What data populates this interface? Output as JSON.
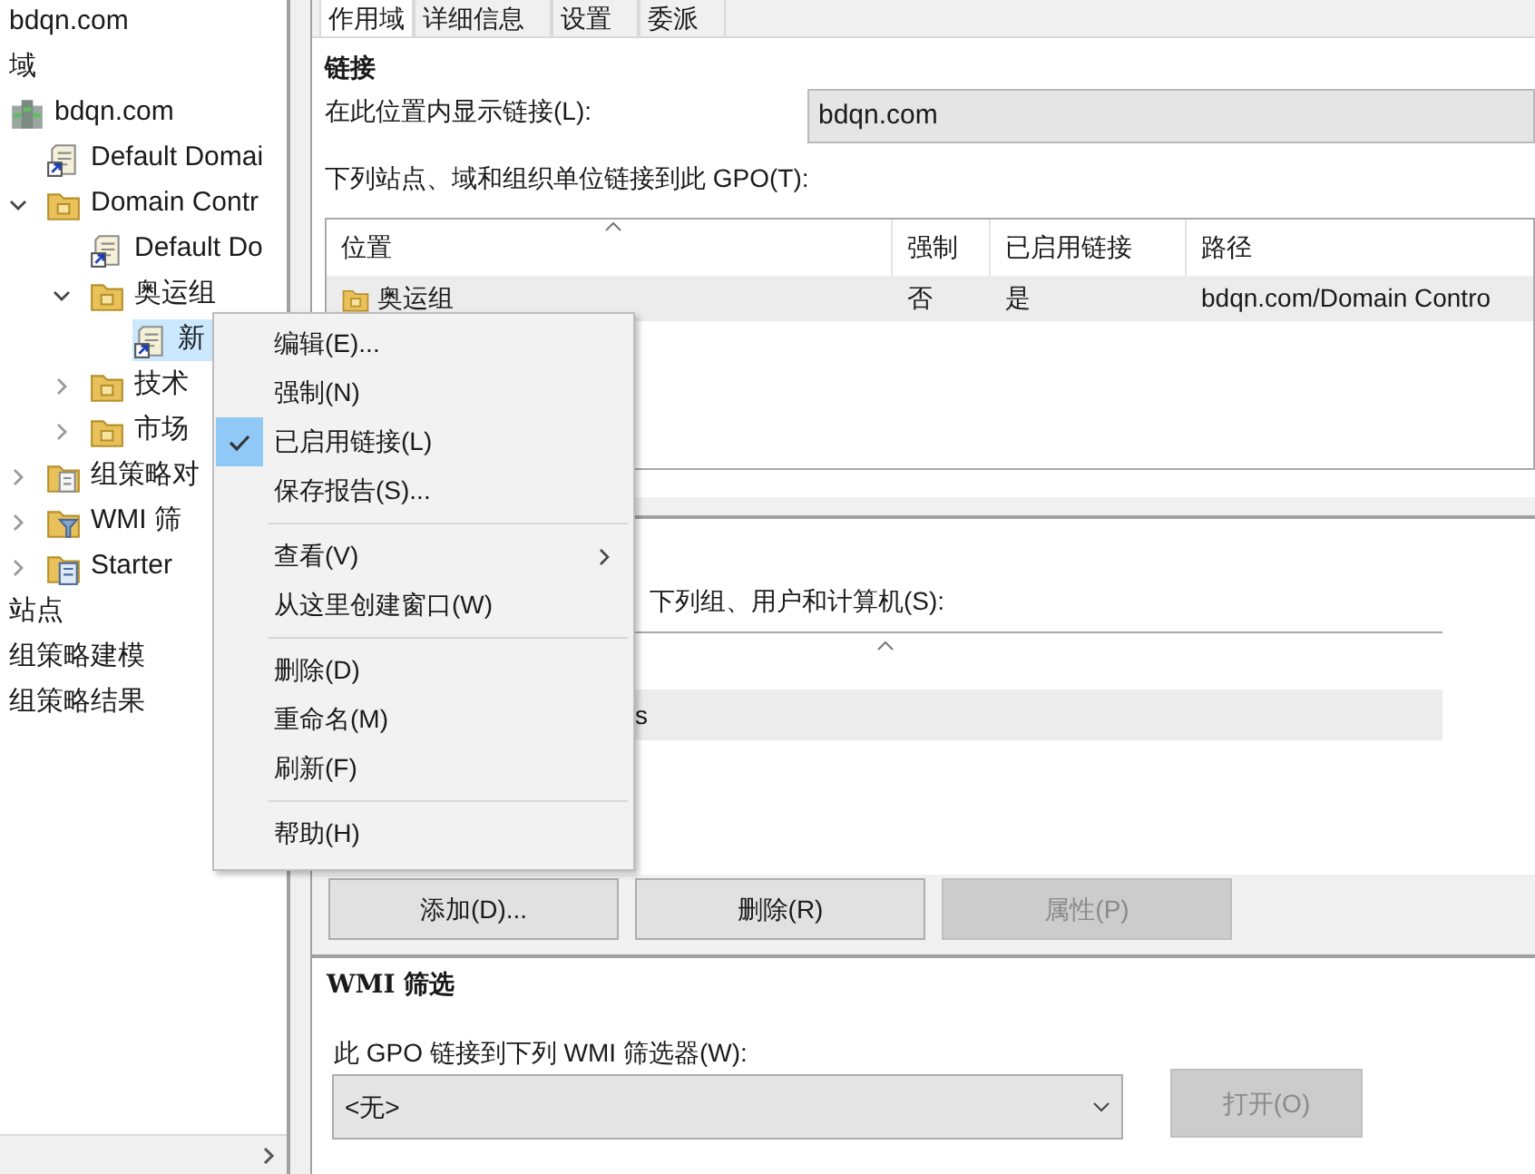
{
  "tree": [
    {
      "label": "bdqn.com",
      "kind": "text",
      "selected": false
    },
    {
      "label": "域",
      "kind": "text",
      "selected": false
    },
    {
      "label": "bdqn.com",
      "kind": "domain",
      "selected": false,
      "children": [
        {
          "label": "Default Domai",
          "kind": "gpo",
          "selected": false
        },
        {
          "label": "Domain Contr",
          "kind": "folder",
          "expanded": true,
          "selected": false,
          "children": [
            {
              "label": "Default Do",
              "kind": "gpo",
              "selected": false
            },
            {
              "label": "奥运组",
              "kind": "folder",
              "expanded": true,
              "selected": false,
              "children": [
                {
                  "label": "新",
                  "kind": "gpo",
                  "selected": true
                }
              ]
            },
            {
              "label": "技术",
              "kind": "folder",
              "expanded": false,
              "selected": false
            },
            {
              "label": "市场",
              "kind": "folder",
              "expanded": false,
              "selected": false
            }
          ]
        },
        {
          "label": "组策略对",
          "kind": "gpofolder",
          "expanded": false,
          "selected": false
        },
        {
          "label": "WMI 筛",
          "kind": "wmifolder",
          "expanded": false,
          "selected": false
        },
        {
          "label": "Starter",
          "kind": "starterfolder",
          "expanded": false,
          "selected": false
        }
      ]
    },
    {
      "label": "站点",
      "kind": "text",
      "selected": false
    },
    {
      "label": "组策略建模",
      "kind": "text",
      "selected": false
    },
    {
      "label": "组策略结果",
      "kind": "text",
      "selected": false
    }
  ],
  "tabs": [
    {
      "label": "作用域",
      "selected": true
    },
    {
      "label": "详细信息",
      "selected": false
    },
    {
      "label": "设置",
      "selected": false
    },
    {
      "label": "委派",
      "selected": false
    }
  ],
  "links": {
    "heading": "链接",
    "location_label": "在此位置内显示链接(L):",
    "location_value": "bdqn.com",
    "list_label": "下列站点、域和组织单位链接到此 GPO(T):",
    "columns": [
      "位置",
      "强制",
      "已启用链接",
      "路径"
    ],
    "rows": [
      {
        "cells": [
          "奥运组",
          "否",
          "是",
          "bdqn.com/Domain Contro"
        ]
      }
    ]
  },
  "security": {
    "label": "下列组、用户和计算机(S):",
    "rows": [
      "s"
    ],
    "buttons": [
      {
        "label": "添加(D)...",
        "disabled": false
      },
      {
        "label": "删除(R)",
        "disabled": false
      },
      {
        "label": "属性(P)",
        "disabled": true
      }
    ]
  },
  "wmi": {
    "heading": "WMI 筛选",
    "label": "此 GPO 链接到下列 WMI 筛选器(W):",
    "value": "<无>",
    "button": {
      "label": "打开(O)",
      "disabled": true
    }
  },
  "context_menu": [
    {
      "kind": "item",
      "label": "编辑(E)...",
      "checked": false
    },
    {
      "kind": "item",
      "label": "强制(N)",
      "checked": false
    },
    {
      "kind": "item",
      "label": "已启用链接(L)",
      "checked": true
    },
    {
      "kind": "item",
      "label": "保存报告(S)...",
      "checked": false
    },
    {
      "kind": "separator"
    },
    {
      "kind": "submenu",
      "label": "查看(V)",
      "checked": false
    },
    {
      "kind": "item",
      "label": "从这里创建窗口(W)",
      "checked": false
    },
    {
      "kind": "separator"
    },
    {
      "kind": "item",
      "label": "删除(D)",
      "checked": false
    },
    {
      "kind": "item",
      "label": "重命名(M)",
      "checked": false
    },
    {
      "kind": "item",
      "label": "刷新(F)",
      "checked": false
    },
    {
      "kind": "separator"
    },
    {
      "kind": "item",
      "label": "帮助(H)",
      "checked": false
    }
  ]
}
